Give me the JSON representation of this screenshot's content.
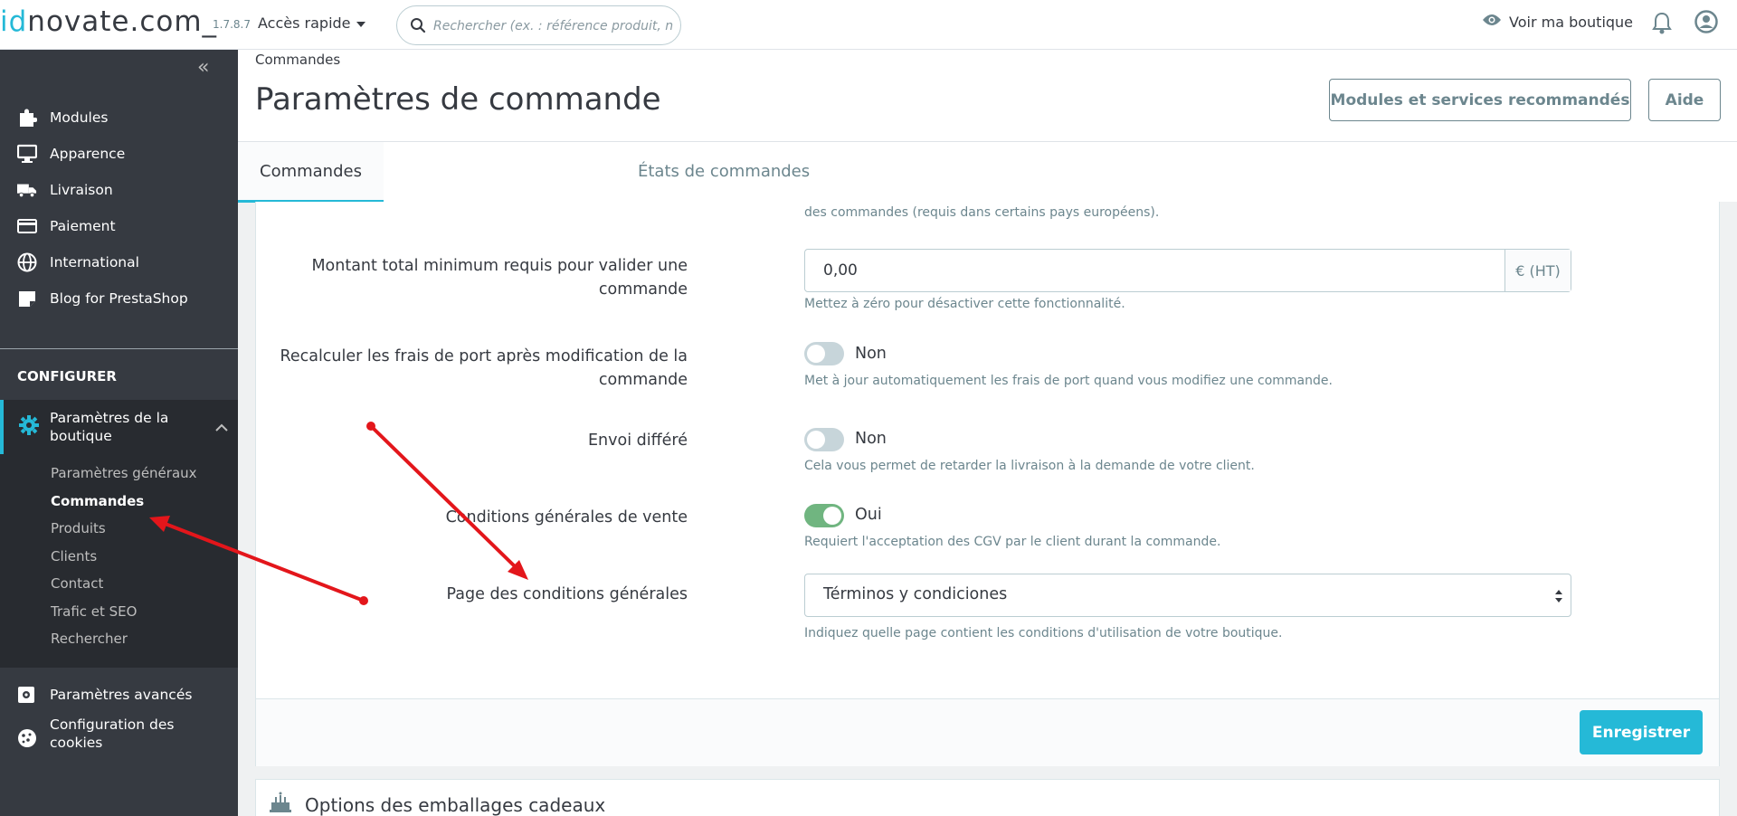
{
  "header": {
    "logo_dark_1": "id",
    "logo_main": "novate.com_",
    "version": "1.7.8.7",
    "quick_access": "Accès rapide",
    "search_placeholder": "Rechercher (ex. : référence produit, no",
    "view_shop": "Voir ma boutique"
  },
  "sidebar": {
    "items": [
      {
        "label": "Modules",
        "icon": "puzzle-icon"
      },
      {
        "label": "Apparence",
        "icon": "monitor-icon"
      },
      {
        "label": "Livraison",
        "icon": "truck-icon"
      },
      {
        "label": "Paiement",
        "icon": "credit-card-icon"
      },
      {
        "label": "International",
        "icon": "globe-icon"
      },
      {
        "label": "Blog for PrestaShop",
        "icon": "note-icon"
      }
    ],
    "section_configure": "CONFIGURER",
    "active_item": "Paramètres de la boutique",
    "submenu": [
      "Paramètres généraux",
      "Commandes",
      "Produits",
      "Clients",
      "Contact",
      "Trafic et SEO",
      "Rechercher"
    ],
    "advanced": "Paramètres avancés",
    "cookies": "Configuration des cookies"
  },
  "page": {
    "breadcrumb": "Commandes",
    "title": "Paramètres de commande",
    "btn_modules": "Modules et services recommandés",
    "btn_help": "Aide",
    "tabs": [
      "Commandes",
      "États de commandes"
    ]
  },
  "form": {
    "cut_help": "des commandes (requis dans certains pays européens).",
    "min_amount_label": "Montant total minimum requis pour valider une commande",
    "min_amount_value": "0,00",
    "min_amount_addon": "€ (HT)",
    "min_amount_help": "Mettez à zéro pour désactiver cette fonctionnalité.",
    "recalc_label": "Recalculer les frais de port après modification de la commande",
    "recalc_state": "Non",
    "recalc_help": "Met à jour automatiquement les frais de port quand vous modifiez une commande.",
    "delayed_label": "Envoi différé",
    "delayed_state": "Non",
    "delayed_help": "Cela vous permet de retarder la livraison à la demande de votre client.",
    "cgv_label": "Conditions générales de vente",
    "cgv_state": "Oui",
    "cgv_help": "Requiert l'acceptation des CGV par le client durant la commande.",
    "cgv_page_label": "Page des conditions générales",
    "cgv_page_value": "Términos y condiciones",
    "cgv_page_help": "Indiquez quelle page contient les conditions d'utilisation de votre boutique.",
    "save": "Enregistrer"
  },
  "gift_card": {
    "title": "Options des emballages cadeaux"
  },
  "colors": {
    "accent": "#25b9d7",
    "sidebar_bg": "#363a41",
    "switch_on": "#70b580",
    "annotation_arrow": "#e3161b"
  }
}
